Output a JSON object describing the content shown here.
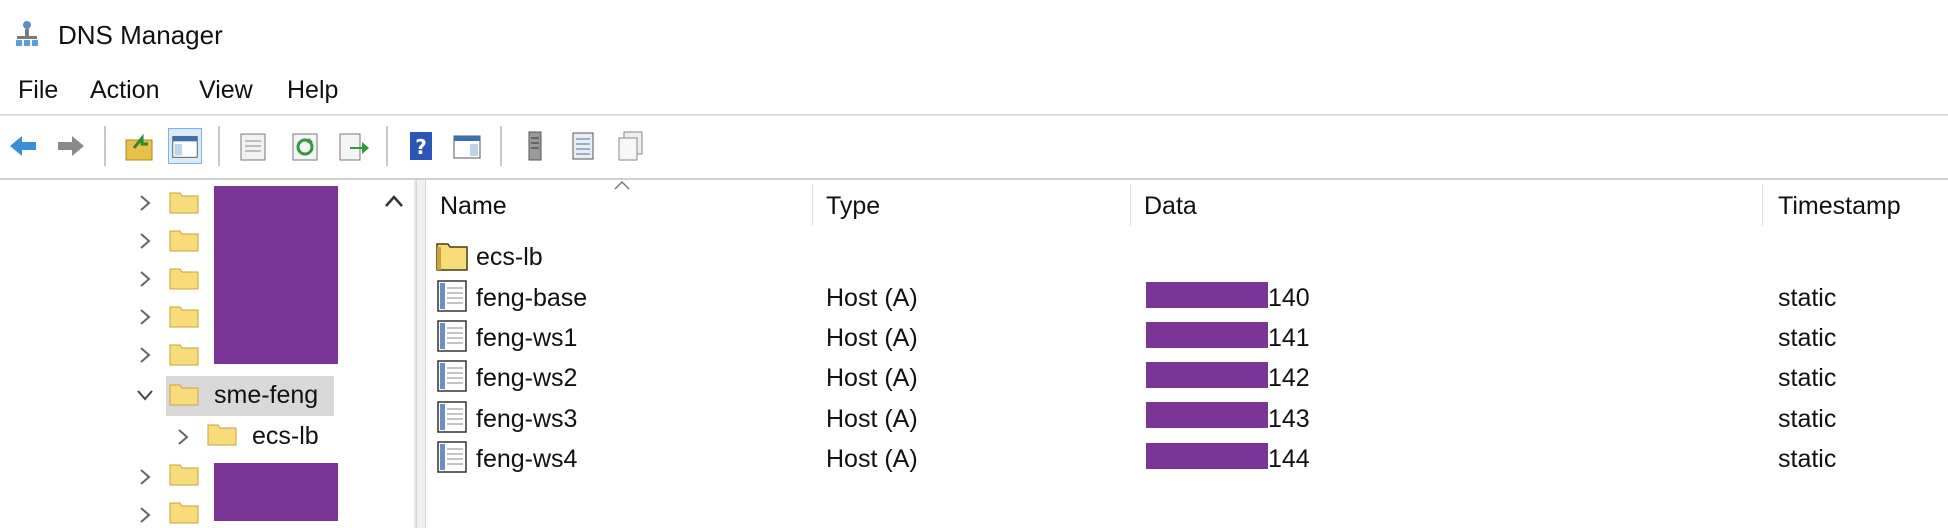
{
  "window": {
    "title": "DNS Manager"
  },
  "menu": [
    "File",
    "Action",
    "View",
    "Help"
  ],
  "toolbar": {
    "buttons": [
      "back-icon",
      "forward-icon",
      "up-level-icon",
      "show-hide-tree-icon",
      "properties-icon",
      "refresh-icon",
      "export-list-icon",
      "help-icon",
      "show-action-pane-icon",
      "server-icon",
      "records-list-icon",
      "copy-icon"
    ]
  },
  "tree": {
    "items": [
      {
        "label": "",
        "redacted": true,
        "expanded": false
      },
      {
        "label": "",
        "redacted": true,
        "expanded": false
      },
      {
        "label": "",
        "redacted": true,
        "expanded": false
      },
      {
        "label": "",
        "redacted": true,
        "expanded": false
      },
      {
        "label": "",
        "redacted": true,
        "expanded": false
      },
      {
        "label": "sme-feng",
        "selected": true,
        "expanded": true
      },
      {
        "label": "ecs-lb",
        "child": true,
        "expanded": false
      },
      {
        "label": "",
        "redacted": true,
        "expanded": false
      },
      {
        "label": "",
        "redacted": true,
        "expanded": false
      }
    ]
  },
  "list": {
    "columns": [
      "Name",
      "Type",
      "Data",
      "Timestamp"
    ],
    "rows": [
      {
        "name": "ecs-lb",
        "type": "",
        "data": "",
        "timestamp": "",
        "kind": "folder"
      },
      {
        "name": "feng-base",
        "type": "Host (A)",
        "data": "140",
        "timestamp": "static",
        "kind": "record"
      },
      {
        "name": "feng-ws1",
        "type": "Host (A)",
        "data": "141",
        "timestamp": "static",
        "kind": "record"
      },
      {
        "name": "feng-ws2",
        "type": "Host (A)",
        "data": "142",
        "timestamp": "static",
        "kind": "record"
      },
      {
        "name": "feng-ws3",
        "type": "Host (A)",
        "data": "143",
        "timestamp": "static",
        "kind": "record"
      },
      {
        "name": "feng-ws4",
        "type": "Host (A)",
        "data": "144",
        "timestamp": "static",
        "kind": "record"
      }
    ]
  },
  "colors": {
    "redaction": "#7b3597",
    "selection": "#d9d9d9",
    "folder": "#f5d36b"
  }
}
